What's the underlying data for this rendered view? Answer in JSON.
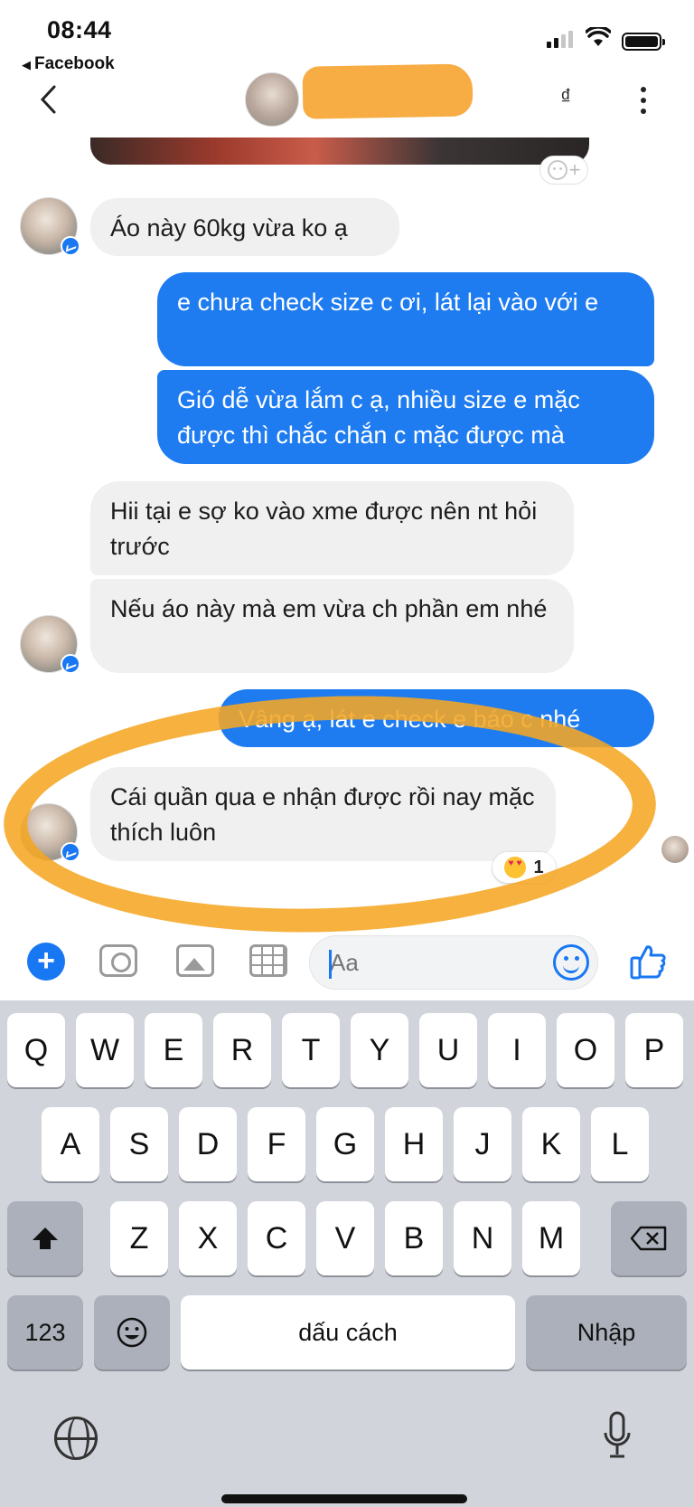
{
  "status_bar": {
    "time": "08:44",
    "back_app_label": "Facebook"
  },
  "header": {
    "currency_icon_glyph": "₫"
  },
  "messages": [
    {
      "side": "in",
      "text": "Áo này 60kg vừa ko ạ"
    },
    {
      "side": "out",
      "text": "e chưa check size c ơi, lát lại vào với e"
    },
    {
      "side": "out",
      "text": "Gió dễ vừa lắm c ạ, nhiều size e mặc được thì chắc chắn c mặc được mà"
    },
    {
      "side": "in",
      "text": "Hii tại e sợ ko vào xme được nên nt hỏi trước"
    },
    {
      "side": "in",
      "text": "Nếu áo này mà em vừa ch phần em nhé"
    },
    {
      "side": "out",
      "text": "Vâng ạ, lát e check e báo c nhé"
    },
    {
      "side": "in",
      "text": "Cái quần qua e nhận được rồi nay mặc thích luôn"
    }
  ],
  "reaction": {
    "emoji": "heart-eyes",
    "count": "1"
  },
  "composer": {
    "placeholder": "Aa"
  },
  "keyboard": {
    "row1": [
      "Q",
      "W",
      "E",
      "R",
      "T",
      "Y",
      "U",
      "I",
      "O",
      "P"
    ],
    "row2": [
      "A",
      "S",
      "D",
      "F",
      "G",
      "H",
      "J",
      "K",
      "L"
    ],
    "row3": [
      "Z",
      "X",
      "C",
      "V",
      "B",
      "N",
      "M"
    ],
    "numbers_key": "123",
    "space_key": "dấu cách",
    "return_key": "Nhập"
  },
  "colors": {
    "outgoing_bubble": "#1e7cf0",
    "incoming_bubble": "#f0f0f0",
    "highlight": "#f5a623",
    "messenger_blue": "#1877f2"
  }
}
